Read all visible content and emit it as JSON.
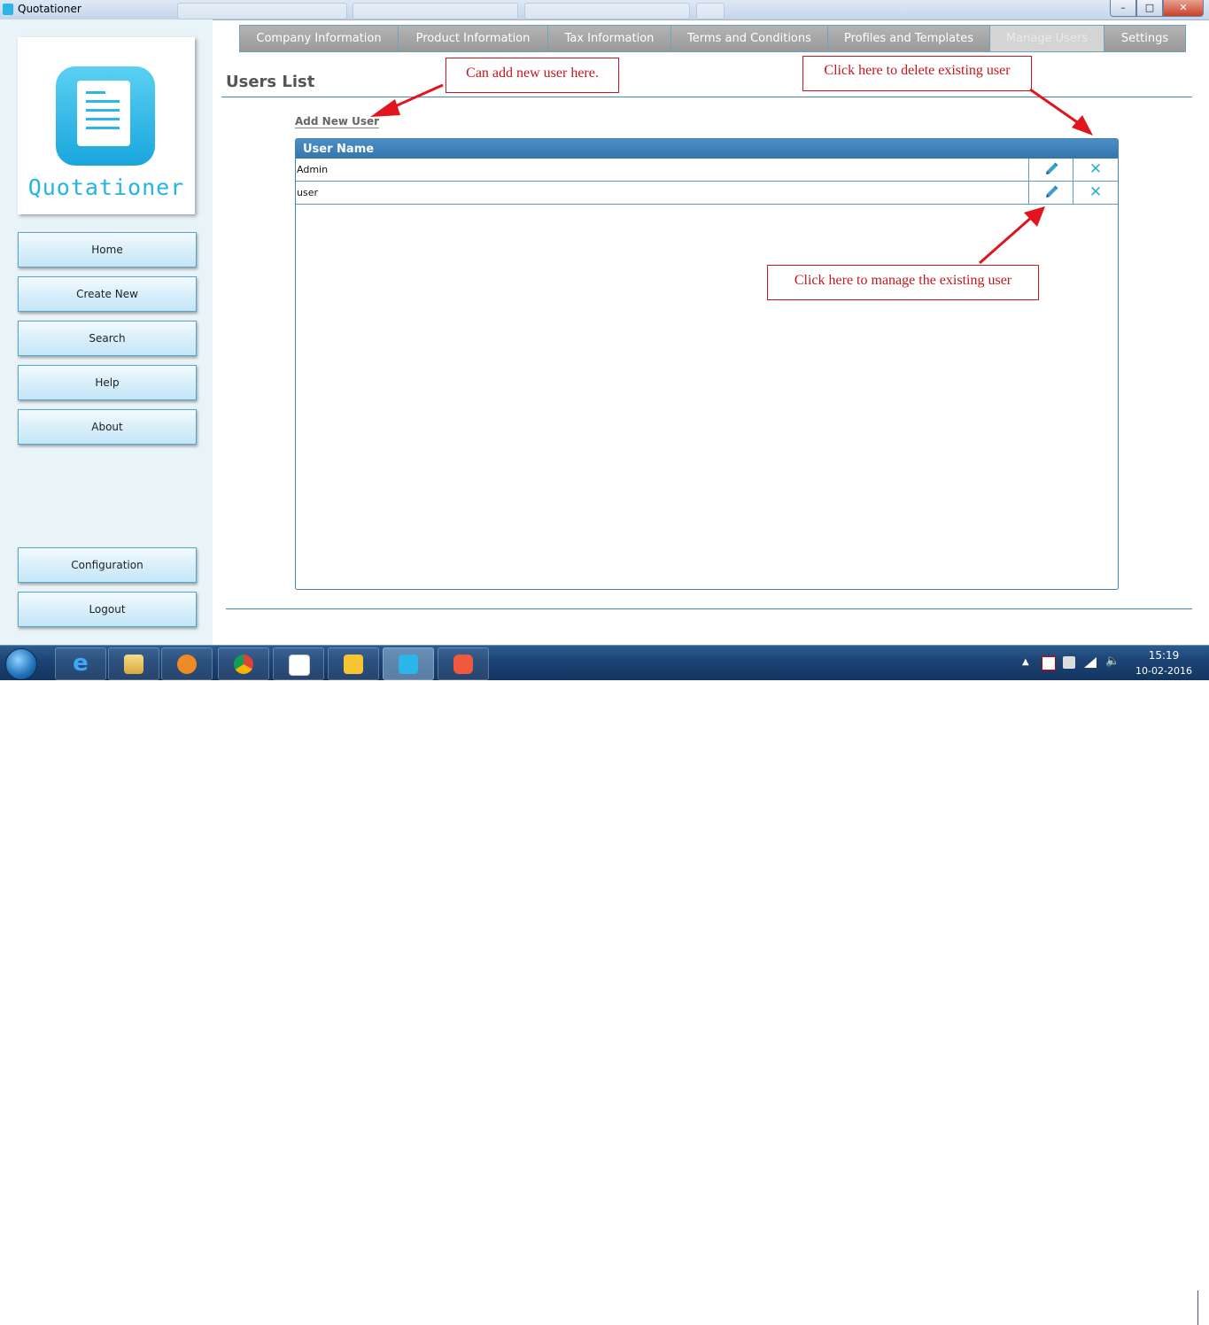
{
  "window": {
    "title": "Quotationer",
    "minimize_label": "–",
    "maximize_label": "□",
    "close_label": "✕"
  },
  "sidebar": {
    "logo_text": "Quotationer",
    "nav": [
      "Home",
      "Create New",
      "Search",
      "Help",
      "About"
    ],
    "bottom_nav": [
      "Configuration",
      "Logout"
    ]
  },
  "tabs": [
    {
      "label": "Company Information",
      "active": false
    },
    {
      "label": "Product Information",
      "active": false
    },
    {
      "label": "Tax Information",
      "active": false
    },
    {
      "label": "Terms and Conditions",
      "active": false
    },
    {
      "label": "Profiles and Templates",
      "active": false
    },
    {
      "label": "Manage Users",
      "active": true
    },
    {
      "label": "Settings",
      "active": false
    }
  ],
  "main": {
    "title": "Users List",
    "add_user_link": "Add New User",
    "grid": {
      "header": "User Name",
      "rows": [
        {
          "name": "Admin",
          "edit_icon": "pencil-icon",
          "delete_icon": "x-icon"
        },
        {
          "name": "user",
          "edit_icon": "pencil-icon",
          "delete_icon": "x-icon"
        }
      ]
    }
  },
  "annotations": {
    "add_user": "Can add new user here.",
    "delete_user": "Click here to delete existing user",
    "manage_user": "Click here to manage the existing user",
    "color": "#c3171b"
  },
  "taskbar": {
    "apps": [
      "internet-explorer-icon",
      "file-explorer-icon",
      "media-player-icon",
      "chrome-icon",
      "app-grid-icon",
      "lightbulb-icon",
      "quotationer-icon",
      "camera-app-icon"
    ],
    "time": "15:19",
    "date": "10-02-2016"
  },
  "colors": {
    "accent": "#3d84b4",
    "sidebar_bg": "#e9f4f9",
    "logo_blue": "#24b4e4",
    "delete_icon": "#29b3c9"
  }
}
